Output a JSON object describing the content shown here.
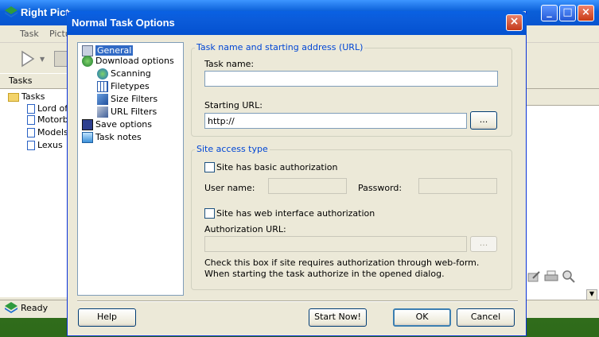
{
  "app": {
    "title": "Right Pict",
    "menu": [
      "Task",
      "Pictu"
    ],
    "tasks_header": "Tasks",
    "tree": [
      "Tasks",
      "Lord of",
      "Motorb",
      "Models",
      "Lexus"
    ],
    "status": "Ready",
    "title_buttons": {
      "minimize": "_",
      "maximize": "□",
      "close": "×"
    }
  },
  "dialog": {
    "title": "Normal Task Options",
    "close_symbol": "×",
    "nav": [
      {
        "label": "General",
        "icon": "wrench-icon",
        "selected": true
      },
      {
        "label": "Download options",
        "icon": "globe-download-icon"
      },
      {
        "label": "Scanning",
        "icon": "globe-scan-icon"
      },
      {
        "label": "Filetypes",
        "icon": "grid-icon"
      },
      {
        "label": "Size Filters",
        "icon": "size-filter-icon"
      },
      {
        "label": "URL Filters",
        "icon": "url-filter-icon"
      },
      {
        "label": "Save options",
        "icon": "floppy-icon"
      },
      {
        "label": "Task notes",
        "icon": "notes-icon"
      }
    ],
    "group_task": {
      "title": "Task name and starting address (URL)",
      "task_name_label": "Task name:",
      "task_name_value": "",
      "starting_url_label": "Starting URL:",
      "starting_url_value": "http://",
      "browse_label": "..."
    },
    "group_site": {
      "title": "Site access type",
      "basic_auth_label": "Site has basic authorization",
      "basic_auth_checked": false,
      "username_label": "User name:",
      "password_label": "Password:",
      "web_auth_label": "Site has web interface authorization",
      "web_auth_checked": false,
      "auth_url_label": "Authorization URL:",
      "auth_browse_label": "...",
      "help_text": "Check this box if site requires authorization through web-form. When starting the task authorize in the opened dialog."
    },
    "buttons": {
      "help": "Help",
      "start_now": "Start Now!",
      "ok": "OK",
      "cancel": "Cancel"
    }
  }
}
